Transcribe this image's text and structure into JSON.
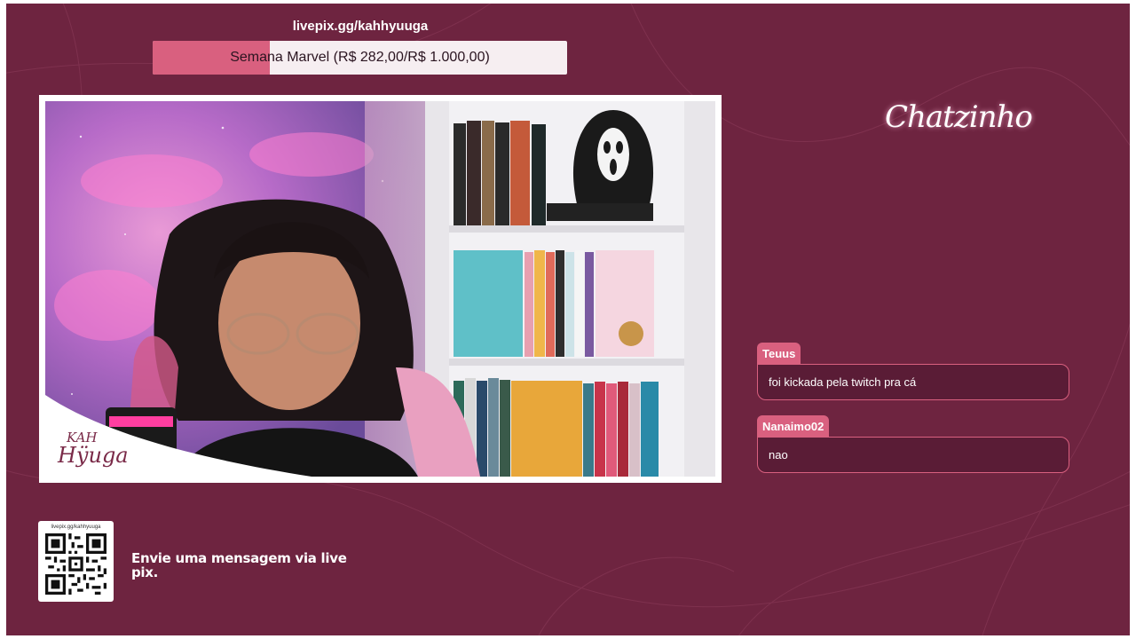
{
  "goal": {
    "url": "livepix.gg/kahhyuuga",
    "label": "Semana Marvel (R$ 282,00/R$ 1.000,00)",
    "progress": 0.282,
    "fill_color": "#d9607f"
  },
  "brand": {
    "logo_line1": "KAH",
    "logo_line2": "Hÿuga"
  },
  "chat": {
    "title": "Chatzinho",
    "messages": [
      {
        "user": "Teuus",
        "text": "foi kickada pela twitch pra cá"
      },
      {
        "user": "Nanaimo02",
        "text": "nao"
      }
    ]
  },
  "qr": {
    "url_label": "livepix.gg/kahhyuuga",
    "message": "Envie uma mensagem via live pix."
  },
  "colors": {
    "background": "#6e2440",
    "accent": "#d9607f",
    "bubble": "#5a1c36"
  }
}
